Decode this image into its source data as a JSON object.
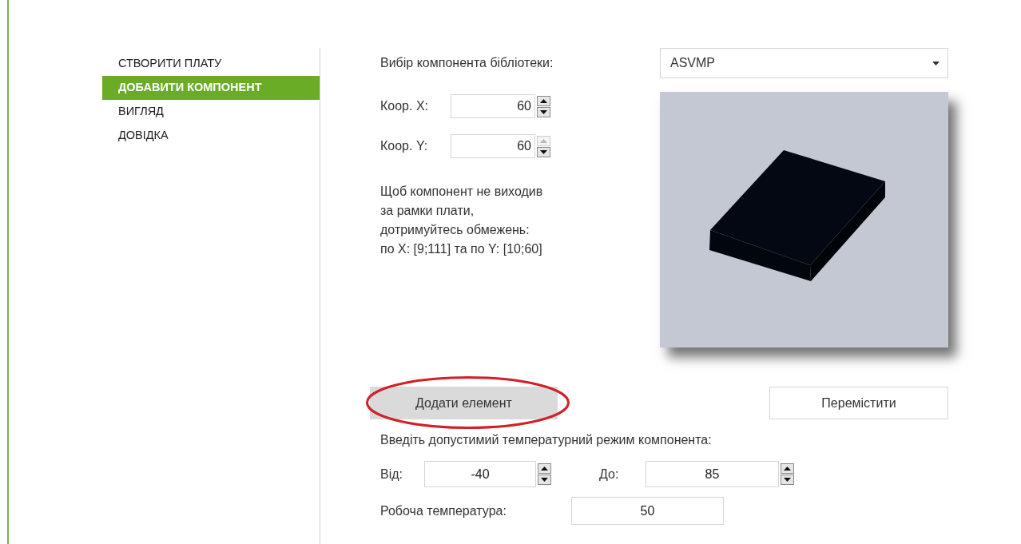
{
  "sidebar": {
    "items": [
      {
        "label": "СТВОРИТИ ПЛАТУ",
        "selected": false
      },
      {
        "label": "ДОБАВИТИ КОМПОНЕНТ",
        "selected": true
      },
      {
        "label": "ВИГЛЯД",
        "selected": false
      },
      {
        "label": "ДОВІДКА",
        "selected": false
      }
    ]
  },
  "library": {
    "label": "Вибір компонента бібліотеки:",
    "value": "ASVMP"
  },
  "coords": [
    {
      "label": "Коор. X:",
      "value": "60",
      "up_enabled": true
    },
    {
      "label": "Коор. Y:",
      "value": "60",
      "up_enabled": false
    }
  ],
  "hint": "Щоб компонент не виходив за рамки плати, дотримуйтесь обмежень:\nпо X: [9;111] та по Y: [10;60]",
  "buttons": [
    {
      "label": "Додати елемент",
      "highlighted": true
    },
    {
      "label": "Перемістити",
      "highlighted": false
    }
  ],
  "temperature": {
    "label": "Введіть допустимий температурний режим компонента:",
    "ranges": [
      {
        "label": "Від:",
        "value": "-40"
      },
      {
        "label": "До:",
        "value": "85"
      }
    ],
    "working": {
      "label": "Робоча температура:",
      "value": "50"
    }
  }
}
